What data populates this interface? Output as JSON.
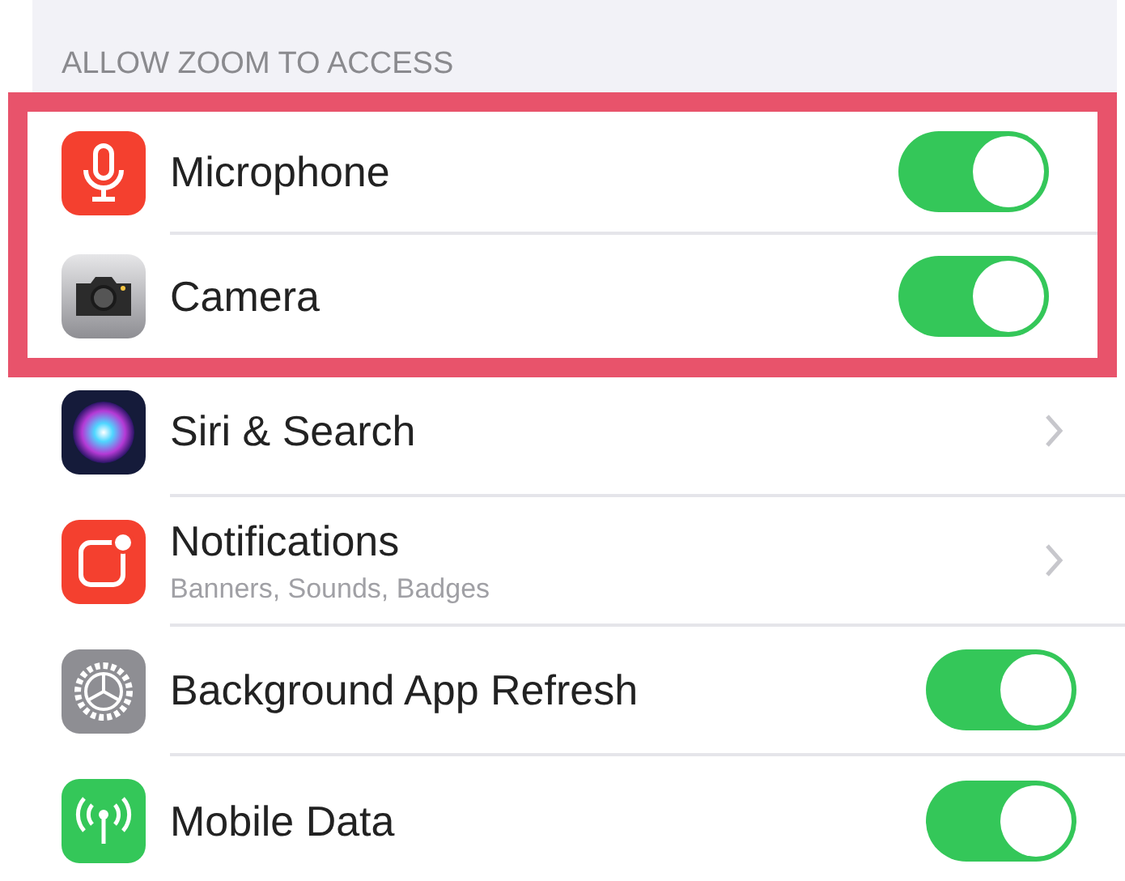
{
  "section_header": "ALLOW ZOOM TO ACCESS",
  "highlighted_rows": [
    {
      "label": "Microphone",
      "kind": "toggle",
      "on": true
    },
    {
      "label": "Camera",
      "kind": "toggle",
      "on": true
    }
  ],
  "rows": [
    {
      "label": "Siri & Search",
      "kind": "link"
    },
    {
      "label": "Notifications",
      "subtitle": "Banners, Sounds, Badges",
      "kind": "link"
    },
    {
      "label": "Background App Refresh",
      "kind": "toggle",
      "on": true
    },
    {
      "label": "Mobile Data",
      "kind": "toggle",
      "on": true
    }
  ]
}
